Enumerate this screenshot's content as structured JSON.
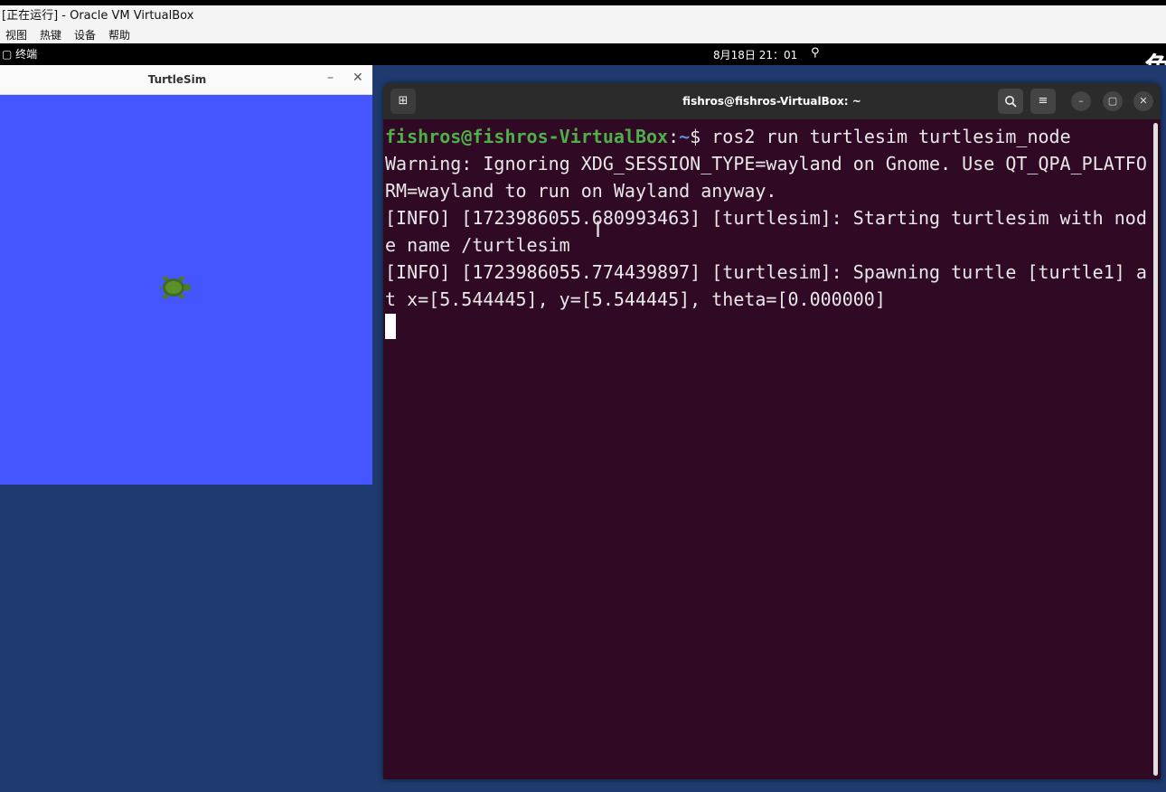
{
  "host": {
    "title": "[正在运行] - Oracle VM VirtualBox",
    "menu": [
      "视图",
      "热键",
      "设备",
      "帮助"
    ]
  },
  "gnome": {
    "activities": "终端",
    "clock": "8月18日  21：01",
    "corner_glyph": "鱼"
  },
  "turtlesim": {
    "title": "TurtleSim",
    "min_label": "–",
    "close_label": "✕",
    "background_color": "#4556ff"
  },
  "terminal": {
    "title": "fishros@fishros-VirtualBox: ~",
    "prompt_user": "fishros@fishros-VirtualBox",
    "prompt_sep": ":",
    "prompt_path": "~",
    "prompt_symbol": "$ ",
    "command": "ros2 run turtlesim turtlesim_node",
    "output_lines": [
      "Warning: Ignoring XDG_SESSION_TYPE=wayland on Gnome. Use QT_QPA_PLATFO",
      "RM=wayland to run on Wayland anyway.",
      "[INFO] [1723986055.680993463] [turtlesim]: Starting turtlesim with nod",
      "e name /turtlesim",
      "[INFO] [1723986055.774439897] [turtlesim]: Spawning turtle [turtle1] a",
      "t x=[5.544445], y=[5.544445], theta=[0.000000]"
    ],
    "buttons": {
      "newtab": "⊞",
      "search": "🔍",
      "menu": "≡",
      "minimize": "–",
      "maximize": "▢",
      "close": "✕"
    },
    "background_color": "#300a24"
  }
}
